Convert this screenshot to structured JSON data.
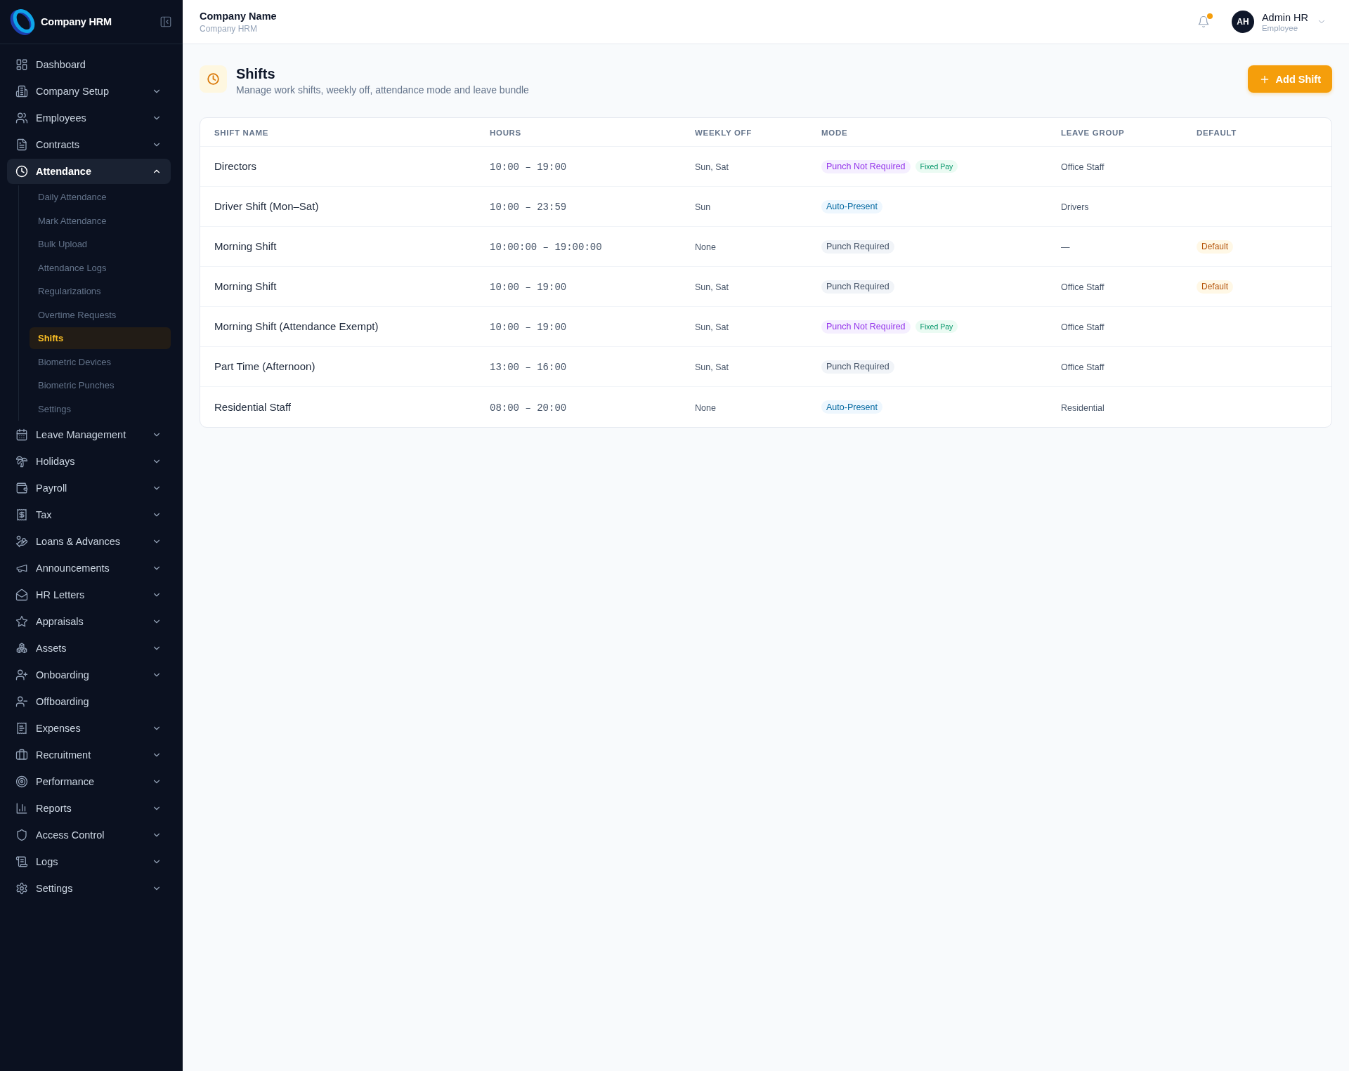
{
  "sidebar": {
    "brand": {
      "name": "Company HRM"
    },
    "items": [
      {
        "label": "Dashboard",
        "kind": "link",
        "selected": false
      },
      {
        "label": "Company Setup",
        "kind": "group",
        "expanded": false,
        "selected": false
      },
      {
        "label": "Employees",
        "kind": "group",
        "expanded": false,
        "selected": false
      },
      {
        "label": "Contracts",
        "kind": "group",
        "expanded": false,
        "selected": false
      },
      {
        "label": "Attendance",
        "kind": "group",
        "expanded": true,
        "selected": true,
        "children": [
          {
            "label": "Daily Attendance",
            "selected": false
          },
          {
            "label": "Mark Attendance",
            "selected": false
          },
          {
            "label": "Bulk Upload",
            "selected": false
          },
          {
            "label": "Attendance Logs",
            "selected": false
          },
          {
            "label": "Regularizations",
            "selected": false
          },
          {
            "label": "Overtime Requests",
            "selected": false
          },
          {
            "label": "Shifts",
            "selected": true
          },
          {
            "label": "Biometric Devices",
            "selected": false
          },
          {
            "label": "Biometric Punches",
            "selected": false
          },
          {
            "label": "Settings",
            "selected": false
          }
        ]
      },
      {
        "label": "Leave Management",
        "kind": "group",
        "expanded": false,
        "selected": false
      },
      {
        "label": "Holidays",
        "kind": "group",
        "expanded": false,
        "selected": false
      },
      {
        "label": "Payroll",
        "kind": "group",
        "expanded": false,
        "selected": false
      },
      {
        "label": "Tax",
        "kind": "group",
        "expanded": false,
        "selected": false
      },
      {
        "label": "Loans & Advances",
        "kind": "group",
        "expanded": false,
        "selected": false
      },
      {
        "label": "Announcements",
        "kind": "group",
        "expanded": false,
        "selected": false
      },
      {
        "label": "HR Letters",
        "kind": "group",
        "expanded": false,
        "selected": false
      },
      {
        "label": "Appraisals",
        "kind": "group",
        "expanded": false,
        "selected": false
      },
      {
        "label": "Assets",
        "kind": "group",
        "expanded": false,
        "selected": false
      },
      {
        "label": "Onboarding",
        "kind": "group",
        "expanded": false,
        "selected": false
      },
      {
        "label": "Offboarding",
        "kind": "link",
        "selected": false
      },
      {
        "label": "Expenses",
        "kind": "group",
        "expanded": false,
        "selected": false
      },
      {
        "label": "Recruitment",
        "kind": "group",
        "expanded": false,
        "selected": false
      },
      {
        "label": "Performance",
        "kind": "group",
        "expanded": false,
        "selected": false
      },
      {
        "label": "Reports",
        "kind": "group",
        "expanded": false,
        "selected": false
      },
      {
        "label": "Access Control",
        "kind": "group",
        "expanded": false,
        "selected": false
      },
      {
        "label": "Logs",
        "kind": "group",
        "expanded": false,
        "selected": false
      },
      {
        "label": "Settings",
        "kind": "group",
        "expanded": false,
        "selected": false
      }
    ]
  },
  "header": {
    "company_name": "Company Name",
    "company_subtitle": "Company HRM",
    "notifications": {
      "unread": true
    },
    "user": {
      "initials": "AH",
      "name": "Admin HR",
      "role": "Employee"
    }
  },
  "page": {
    "title": "Shifts",
    "subtitle": "Manage work shifts, weekly off, attendance mode and leave bundle",
    "add_button": "Add Shift"
  },
  "table": {
    "columns": [
      "SHIFT NAME",
      "HOURS",
      "WEEKLY OFF",
      "MODE",
      "LEAVE GROUP",
      "DEFAULT"
    ],
    "rows": [
      {
        "name": "Directors",
        "hours": "10:00 – 19:00",
        "weekly_off": "Sun, Sat",
        "mode": {
          "label": "Punch Not Required",
          "kind": "exempt"
        },
        "pay_badge": "Fixed Pay",
        "leave_group": "Office Staff"
      },
      {
        "name": "Driver Shift (Mon–Sat)",
        "hours": "10:00 – 23:59",
        "weekly_off": "Sun",
        "mode": {
          "label": "Auto-Present",
          "kind": "auto"
        },
        "leave_group": "Drivers"
      },
      {
        "name": "Morning Shift",
        "hours": "10:00:00 – 19:00:00",
        "weekly_off": "None",
        "mode": {
          "label": "Punch Required",
          "kind": "punch"
        },
        "leave_group": "—",
        "default": "Default"
      },
      {
        "name": "Morning Shift",
        "hours": "10:00 – 19:00",
        "weekly_off": "Sun, Sat",
        "mode": {
          "label": "Punch Required",
          "kind": "punch"
        },
        "leave_group": "Office Staff",
        "default": "Default"
      },
      {
        "name": "Morning Shift (Attendance Exempt)",
        "hours": "10:00 – 19:00",
        "weekly_off": "Sun, Sat",
        "mode": {
          "label": "Punch Not Required",
          "kind": "exempt"
        },
        "pay_badge": "Fixed Pay",
        "leave_group": "Office Staff"
      },
      {
        "name": "Part Time (Afternoon)",
        "hours": "13:00 – 16:00",
        "weekly_off": "Sun, Sat",
        "mode": {
          "label": "Punch Required",
          "kind": "punch"
        },
        "leave_group": "Office Staff"
      },
      {
        "name": "Residential Staff",
        "hours": "08:00 – 20:00",
        "weekly_off": "None",
        "mode": {
          "label": "Auto-Present",
          "kind": "auto"
        },
        "leave_group": "Residential"
      }
    ]
  }
}
